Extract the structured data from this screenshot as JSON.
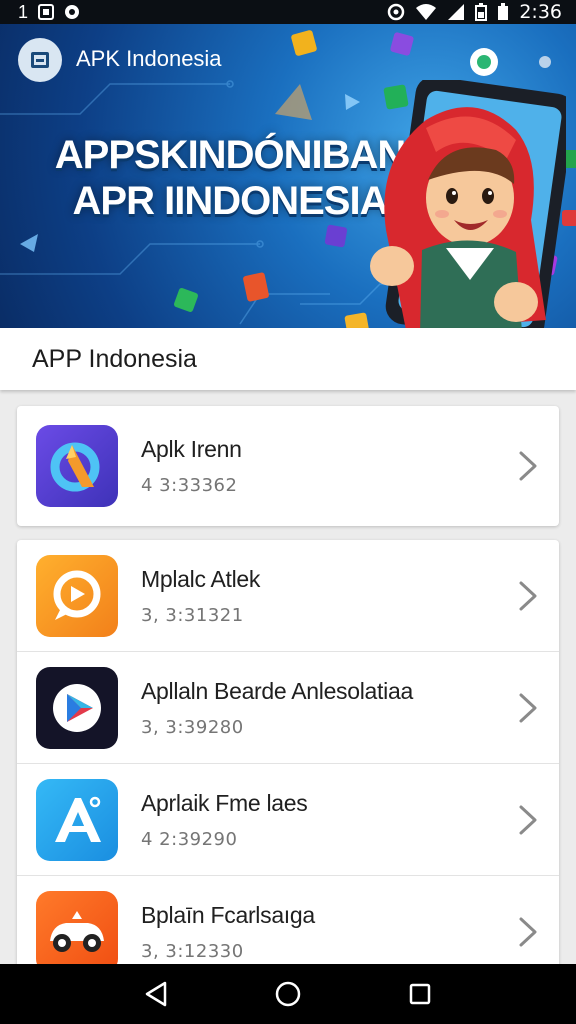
{
  "status_bar": {
    "left_text": "1",
    "time": "2:36",
    "icons": [
      "notification-icon",
      "notification-icon",
      "sync-icon",
      "wifi-icon",
      "signal-icon",
      "battery-icon",
      "battery-icon"
    ]
  },
  "banner": {
    "app_name": "APK Indonesia",
    "headline_line1": "APPSKINDÓNIBAN",
    "headline_line2": "APR IINDONESIA"
  },
  "section": {
    "title": "APP Indonesia"
  },
  "apps": [
    {
      "name": "Aplk Irenn",
      "meta": "4 3:33362",
      "icon": "arc-app-icon",
      "icon_bg": "#5a3fd0"
    },
    {
      "name": "Mplalc Atlek",
      "meta": "3, 3:31321",
      "icon": "chat-app-icon",
      "icon_bg": "#f59a1b"
    },
    {
      "name": "Apllaln Bearde Anlesolatiaa",
      "meta": "3, 3:39280",
      "icon": "play-app-icon",
      "icon_bg": "#141428"
    },
    {
      "name": "Aprlaik Fme laes",
      "meta": "4 2:39290",
      "icon": "letter-a-app-icon",
      "icon_bg": "#1ea7f0"
    },
    {
      "name": "Bplaīn Fcarlsaıga",
      "meta": "3, 3:12330",
      "icon": "car-app-icon",
      "icon_bg": "#f2601e"
    }
  ],
  "nav": {
    "back": "back-icon",
    "home": "home-icon",
    "recents": "recents-icon"
  }
}
